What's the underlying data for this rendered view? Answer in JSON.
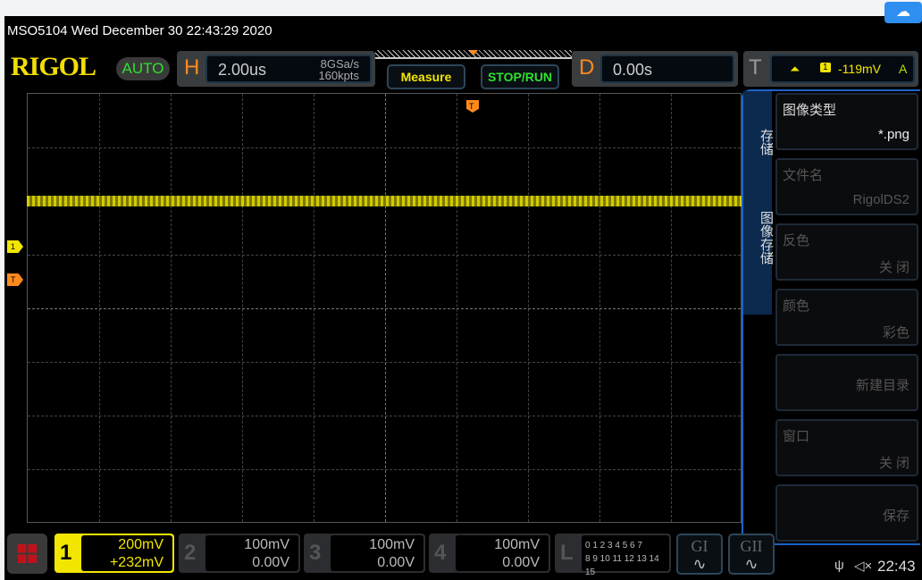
{
  "title": "MSO5104  Wed December 30 22:43:29 2020",
  "logo": "RIGOL",
  "mode": "AUTO",
  "horizontal": {
    "label": "H",
    "timebase": "2.00us",
    "sample_rate": "8GSa/s",
    "memory": "160kpts"
  },
  "buttons": {
    "measure": "Measure",
    "stop_run": "STOP/RUN"
  },
  "delay": {
    "label": "D",
    "value": "0.00s"
  },
  "trigger": {
    "label": "T",
    "source": "1",
    "level": "-119mV",
    "mode": "A"
  },
  "markers": {
    "ch1": "1",
    "trig": "T"
  },
  "menu": {
    "tab1": "存储",
    "tab2": "图像存储",
    "items": [
      {
        "label": "图像类型",
        "value": "*.png"
      },
      {
        "label": "文件名",
        "value": "RigolDS2"
      },
      {
        "label": "反色",
        "value": "关 闭"
      },
      {
        "label": "颜色",
        "value": "彩色"
      },
      {
        "label": "",
        "value": "新建目录"
      },
      {
        "label": "窗口",
        "value": "关 闭"
      },
      {
        "label": "",
        "value": "保存"
      }
    ]
  },
  "channels": [
    {
      "num": "1",
      "scale": "200mV",
      "offset": "+232mV"
    },
    {
      "num": "2",
      "scale": "100mV",
      "offset": "0.00V"
    },
    {
      "num": "3",
      "scale": "100mV",
      "offset": "0.00V"
    },
    {
      "num": "4",
      "scale": "100mV",
      "offset": "0.00V"
    }
  ],
  "logic": {
    "label": "L",
    "row1": "0 1 2 3  4 5 6 7",
    "row2": "8 9 10 11 12 13 14 15"
  },
  "gen": [
    "GI",
    "GII"
  ],
  "status": {
    "time": "22:43",
    "usb": "ψ",
    "sound": "◁×"
  },
  "colors": {
    "ch1": "#f2e600",
    "accent": "#ff8a1c",
    "menu_border": "#1a64c8"
  }
}
